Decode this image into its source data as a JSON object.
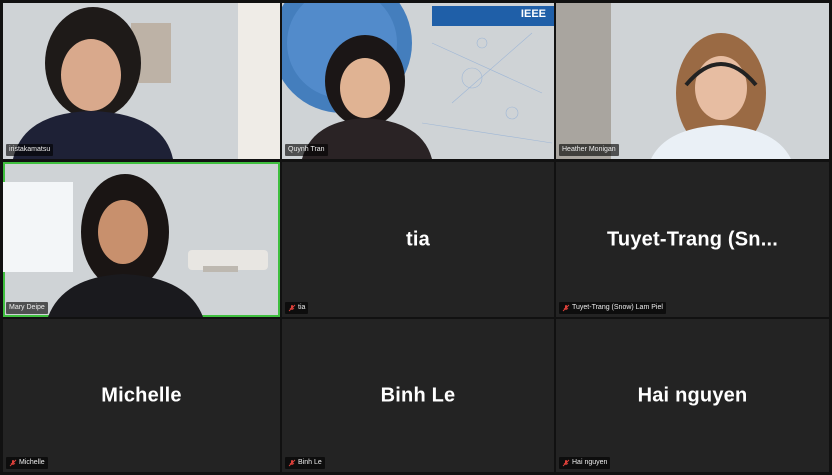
{
  "participants": [
    {
      "id": "p1",
      "name": "iristakamatsu",
      "type": "video"
    },
    {
      "id": "p2",
      "name": "Quynh Tran",
      "type": "video",
      "banner": "IEEE"
    },
    {
      "id": "p3",
      "name": "Heather Monigan",
      "type": "video"
    },
    {
      "id": "p4",
      "name": "Mary Deipe",
      "type": "video",
      "active_speaker": true
    },
    {
      "id": "p5",
      "name": "tia",
      "display": "tia",
      "type": "avatar",
      "muted": true
    },
    {
      "id": "p6",
      "name": "Tuyet-Trang (Snow) Lam Piel",
      "display": "Tuyet-Trang  (Sn...",
      "type": "avatar",
      "muted": true
    },
    {
      "id": "p7",
      "name": "Michelle",
      "display": "Michelle",
      "type": "avatar",
      "muted": true
    },
    {
      "id": "p8",
      "name": "Binh Le",
      "display": "Binh Le",
      "type": "avatar",
      "muted": true
    },
    {
      "id": "p9",
      "name": "Hai nguyen",
      "display": "Hai nguyen",
      "type": "avatar",
      "muted": true
    }
  ],
  "colors": {
    "active_border": "#3fbf3f",
    "muted_icon": "#e0413a",
    "tile_bg": "#232323"
  }
}
